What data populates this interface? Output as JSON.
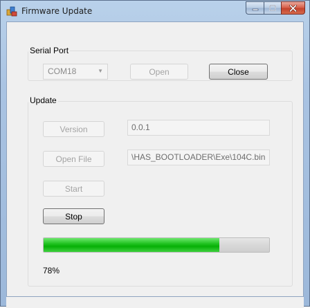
{
  "window": {
    "title": "Firmware Update",
    "icon": "firmware-app-icon"
  },
  "serial_port": {
    "label": "Serial Port",
    "port_value": "COM18",
    "open_label": "Open",
    "close_label": "Close"
  },
  "update": {
    "label": "Update",
    "version_label": "Version",
    "version_value": "0.0.1",
    "open_file_label": "Open File",
    "file_path": "\\HAS_BOOTLOADER\\Exe\\104C.bin",
    "start_label": "Start",
    "stop_label": "Stop",
    "progress": 0.78,
    "progress_text": "78%"
  },
  "colors": {
    "progress_fill": "#0fb80f",
    "title_bar": "#b9d1ea",
    "close_button": "#c94a32"
  }
}
